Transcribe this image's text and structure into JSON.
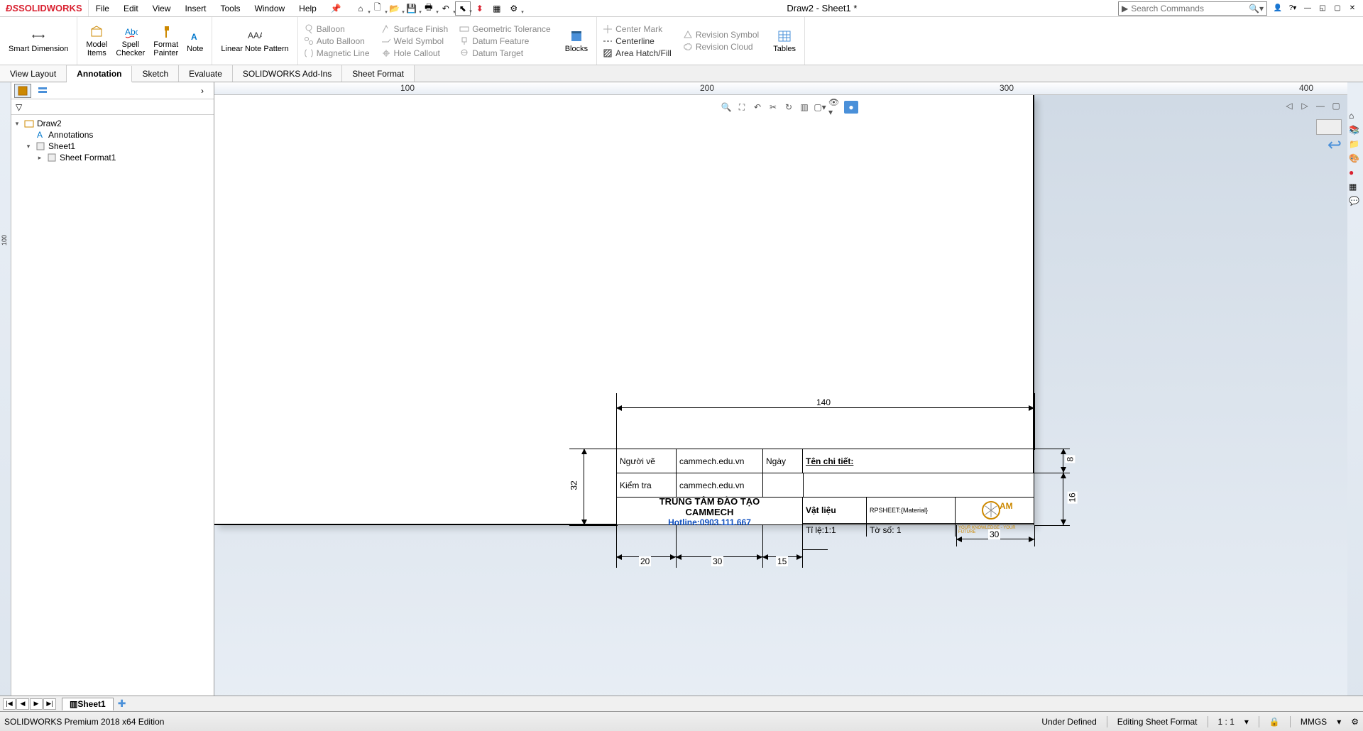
{
  "app": {
    "brand_prefix": "S",
    "brand": "SOLIDWORKS",
    "title": "Draw2 - Sheet1 *"
  },
  "menu": [
    "File",
    "Edit",
    "View",
    "Insert",
    "Tools",
    "Window",
    "Help"
  ],
  "search": {
    "placeholder": "Search Commands"
  },
  "ribbon": {
    "smart_dim": "Smart Dimension",
    "model_items": "Model\nItems",
    "spell": "Spell\nChecker",
    "fmt": "Format\nPainter",
    "note": "Note",
    "lnp": "Linear Note Pattern",
    "balloon": "Balloon",
    "auto_balloon": "Auto Balloon",
    "magline": "Magnetic Line",
    "sfinish": "Surface Finish",
    "weld": "Weld Symbol",
    "hole": "Hole Callout",
    "geotol": "Geometric Tolerance",
    "datumf": "Datum Feature",
    "datumt": "Datum Target",
    "blocks": "Blocks",
    "centermark": "Center Mark",
    "centerline": "Centerline",
    "areahatch": "Area Hatch/Fill",
    "revsym": "Revision Symbol",
    "revcloud": "Revision Cloud",
    "tables": "Tables"
  },
  "tabs": [
    "View Layout",
    "Annotation",
    "Sketch",
    "Evaluate",
    "SOLIDWORKS Add-Ins",
    "Sheet Format"
  ],
  "tree": {
    "root": "Draw2",
    "ann": "Annotations",
    "sheet": "Sheet1",
    "fmt": "Sheet Format1"
  },
  "ruler": {
    "h": [
      "100",
      "200",
      "300",
      "400"
    ],
    "v": "100"
  },
  "titleblock": {
    "r1c1": "Người vẽ",
    "r1c2": "cammech.edu.vn",
    "r1c3": "Ngày",
    "r1c4": "Tên chi tiết:",
    "r2c1": "Kiểm tra",
    "r2c2": "cammech.edu.vn",
    "org1": "TRUNG TÂM ĐÀO TẠO",
    "org2": "CAMMECH",
    "org3": "Hotline:0903.111.667",
    "mat": "Vật liệu",
    "matv": "RPSHEET:{Material}",
    "scale": "Tỉ lệ:1:1",
    "sheetno": "Tờ số: 1"
  },
  "dims": {
    "d140": "140",
    "d32": "32",
    "d20": "20",
    "d30a": "30",
    "d15": "15",
    "d30b": "30",
    "d8": "8",
    "d16": "16"
  },
  "bottom_tab": "Sheet1",
  "status": {
    "edition": "SOLIDWORKS Premium 2018 x64 Edition",
    "def": "Under Defined",
    "edit": "Editing Sheet Format",
    "ratio": "1 : 1",
    "units": "MMGS"
  }
}
